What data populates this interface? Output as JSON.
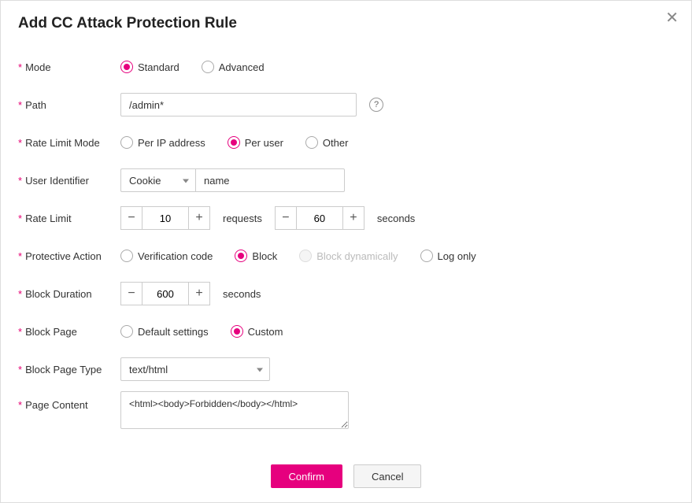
{
  "title": "Add CC Attack Protection Rule",
  "labels": {
    "mode": "Mode",
    "path": "Path",
    "rate_limit_mode": "Rate Limit Mode",
    "user_identifier": "User Identifier",
    "rate_limit": "Rate Limit",
    "protective_action": "Protective Action",
    "block_duration": "Block Duration",
    "block_page": "Block Page",
    "block_page_type": "Block Page Type",
    "page_content": "Page Content"
  },
  "mode": {
    "options": {
      "standard": "Standard",
      "advanced": "Advanced"
    },
    "selected": "standard"
  },
  "path": {
    "value": "/admin*"
  },
  "rate_limit_mode": {
    "options": {
      "per_ip": "Per IP address",
      "per_user": "Per user",
      "other": "Other"
    },
    "selected": "per_user"
  },
  "user_identifier": {
    "type_selected": "Cookie",
    "value": "name"
  },
  "rate_limit": {
    "requests": 10,
    "seconds": 60,
    "requests_label": "requests",
    "seconds_label": "seconds"
  },
  "protective_action": {
    "options": {
      "verification_code": "Verification code",
      "block": "Block",
      "block_dynamically": "Block dynamically",
      "log_only": "Log only"
    },
    "selected": "block",
    "disabled": [
      "block_dynamically"
    ]
  },
  "block_duration": {
    "value": 600,
    "unit": "seconds"
  },
  "block_page": {
    "options": {
      "default": "Default settings",
      "custom": "Custom"
    },
    "selected": "custom"
  },
  "block_page_type": {
    "selected": "text/html"
  },
  "page_content": {
    "value": "<html><body>Forbidden</body></html>"
  },
  "buttons": {
    "confirm": "Confirm",
    "cancel": "Cancel"
  },
  "icons": {
    "minus": "−",
    "plus": "+",
    "help": "?",
    "close": "✕"
  }
}
